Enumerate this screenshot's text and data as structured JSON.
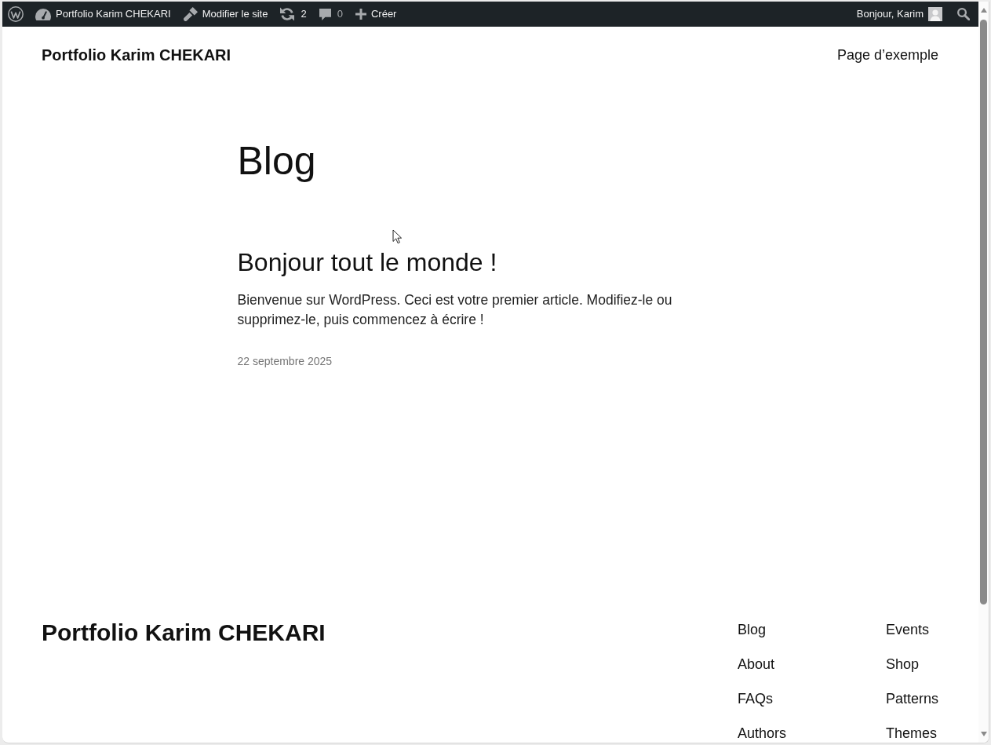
{
  "admin_bar": {
    "items": [
      {
        "kind": "site",
        "label": "Portfolio Karim CHEKARI"
      },
      {
        "kind": "edit",
        "label": "Modifier le site"
      },
      {
        "kind": "updates",
        "label": "2"
      },
      {
        "kind": "comments",
        "label": "0"
      },
      {
        "kind": "new",
        "label": "Créer"
      }
    ],
    "greeting": "Bonjour, Karim"
  },
  "header": {
    "site_title": "Portfolio Karim CHEKARI",
    "nav": [
      "Page d’exemple"
    ]
  },
  "page": {
    "title": "Blog",
    "posts": [
      {
        "title": "Bonjour tout le monde !",
        "excerpt": "Bienvenue sur WordPress. Ceci est votre premier article. Modifiez-le ou supprimez-le, puis commencez à écrire !",
        "date": "22 septembre 2025"
      }
    ]
  },
  "footer": {
    "site_title": "Portfolio Karim CHEKARI",
    "nav_columns": [
      [
        "Blog",
        "About",
        "FAQs",
        "Authors"
      ],
      [
        "Events",
        "Shop",
        "Patterns",
        "Themes"
      ]
    ]
  }
}
